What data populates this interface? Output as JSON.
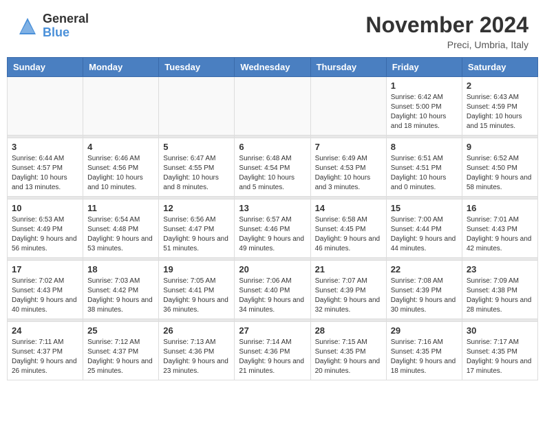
{
  "header": {
    "logo_general": "General",
    "logo_blue": "Blue",
    "month_title": "November 2024",
    "location": "Preci, Umbria, Italy"
  },
  "days_of_week": [
    "Sunday",
    "Monday",
    "Tuesday",
    "Wednesday",
    "Thursday",
    "Friday",
    "Saturday"
  ],
  "weeks": [
    [
      {
        "day": "",
        "empty": true
      },
      {
        "day": "",
        "empty": true
      },
      {
        "day": "",
        "empty": true
      },
      {
        "day": "",
        "empty": true
      },
      {
        "day": "",
        "empty": true
      },
      {
        "day": "1",
        "sunrise": "6:42 AM",
        "sunset": "5:00 PM",
        "daylight": "10 hours and 18 minutes."
      },
      {
        "day": "2",
        "sunrise": "6:43 AM",
        "sunset": "4:59 PM",
        "daylight": "10 hours and 15 minutes."
      }
    ],
    [
      {
        "day": "3",
        "sunrise": "6:44 AM",
        "sunset": "4:57 PM",
        "daylight": "10 hours and 13 minutes."
      },
      {
        "day": "4",
        "sunrise": "6:46 AM",
        "sunset": "4:56 PM",
        "daylight": "10 hours and 10 minutes."
      },
      {
        "day": "5",
        "sunrise": "6:47 AM",
        "sunset": "4:55 PM",
        "daylight": "10 hours and 8 minutes."
      },
      {
        "day": "6",
        "sunrise": "6:48 AM",
        "sunset": "4:54 PM",
        "daylight": "10 hours and 5 minutes."
      },
      {
        "day": "7",
        "sunrise": "6:49 AM",
        "sunset": "4:53 PM",
        "daylight": "10 hours and 3 minutes."
      },
      {
        "day": "8",
        "sunrise": "6:51 AM",
        "sunset": "4:51 PM",
        "daylight": "10 hours and 0 minutes."
      },
      {
        "day": "9",
        "sunrise": "6:52 AM",
        "sunset": "4:50 PM",
        "daylight": "9 hours and 58 minutes."
      }
    ],
    [
      {
        "day": "10",
        "sunrise": "6:53 AM",
        "sunset": "4:49 PM",
        "daylight": "9 hours and 56 minutes."
      },
      {
        "day": "11",
        "sunrise": "6:54 AM",
        "sunset": "4:48 PM",
        "daylight": "9 hours and 53 minutes."
      },
      {
        "day": "12",
        "sunrise": "6:56 AM",
        "sunset": "4:47 PM",
        "daylight": "9 hours and 51 minutes."
      },
      {
        "day": "13",
        "sunrise": "6:57 AM",
        "sunset": "4:46 PM",
        "daylight": "9 hours and 49 minutes."
      },
      {
        "day": "14",
        "sunrise": "6:58 AM",
        "sunset": "4:45 PM",
        "daylight": "9 hours and 46 minutes."
      },
      {
        "day": "15",
        "sunrise": "7:00 AM",
        "sunset": "4:44 PM",
        "daylight": "9 hours and 44 minutes."
      },
      {
        "day": "16",
        "sunrise": "7:01 AM",
        "sunset": "4:43 PM",
        "daylight": "9 hours and 42 minutes."
      }
    ],
    [
      {
        "day": "17",
        "sunrise": "7:02 AM",
        "sunset": "4:43 PM",
        "daylight": "9 hours and 40 minutes."
      },
      {
        "day": "18",
        "sunrise": "7:03 AM",
        "sunset": "4:42 PM",
        "daylight": "9 hours and 38 minutes."
      },
      {
        "day": "19",
        "sunrise": "7:05 AM",
        "sunset": "4:41 PM",
        "daylight": "9 hours and 36 minutes."
      },
      {
        "day": "20",
        "sunrise": "7:06 AM",
        "sunset": "4:40 PM",
        "daylight": "9 hours and 34 minutes."
      },
      {
        "day": "21",
        "sunrise": "7:07 AM",
        "sunset": "4:39 PM",
        "daylight": "9 hours and 32 minutes."
      },
      {
        "day": "22",
        "sunrise": "7:08 AM",
        "sunset": "4:39 PM",
        "daylight": "9 hours and 30 minutes."
      },
      {
        "day": "23",
        "sunrise": "7:09 AM",
        "sunset": "4:38 PM",
        "daylight": "9 hours and 28 minutes."
      }
    ],
    [
      {
        "day": "24",
        "sunrise": "7:11 AM",
        "sunset": "4:37 PM",
        "daylight": "9 hours and 26 minutes."
      },
      {
        "day": "25",
        "sunrise": "7:12 AM",
        "sunset": "4:37 PM",
        "daylight": "9 hours and 25 minutes."
      },
      {
        "day": "26",
        "sunrise": "7:13 AM",
        "sunset": "4:36 PM",
        "daylight": "9 hours and 23 minutes."
      },
      {
        "day": "27",
        "sunrise": "7:14 AM",
        "sunset": "4:36 PM",
        "daylight": "9 hours and 21 minutes."
      },
      {
        "day": "28",
        "sunrise": "7:15 AM",
        "sunset": "4:35 PM",
        "daylight": "9 hours and 20 minutes."
      },
      {
        "day": "29",
        "sunrise": "7:16 AM",
        "sunset": "4:35 PM",
        "daylight": "9 hours and 18 minutes."
      },
      {
        "day": "30",
        "sunrise": "7:17 AM",
        "sunset": "4:35 PM",
        "daylight": "9 hours and 17 minutes."
      }
    ]
  ]
}
